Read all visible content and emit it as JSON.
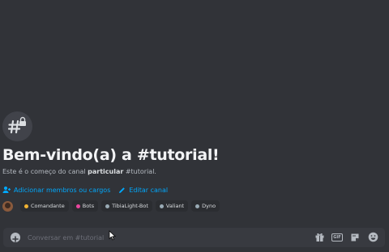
{
  "welcome": {
    "title": "Bem-vindo(a) a #tutorial!",
    "desc_prefix": "Este é o começo do canal ",
    "desc_strong": "particular",
    "desc_suffix": " #tutorial."
  },
  "actions": {
    "add_members": "Adicionar membros ou cargos",
    "edit_channel": "Editar canal"
  },
  "roles": [
    {
      "name": "Comandante",
      "color": "#f0b232"
    },
    {
      "name": "Bots",
      "color": "#eb459e"
    },
    {
      "name": "TibiaLight-Bot",
      "color": "#99aab5"
    },
    {
      "name": "Valiant",
      "color": "#99aab5"
    },
    {
      "name": "Dyno",
      "color": "#99aab5"
    }
  ],
  "composer": {
    "placeholder": "Conversar em #tutorial",
    "gif_label": "GIF"
  },
  "colors": {
    "background": "#313338",
    "link": "#00a8fc",
    "input_bg": "#383a40"
  }
}
